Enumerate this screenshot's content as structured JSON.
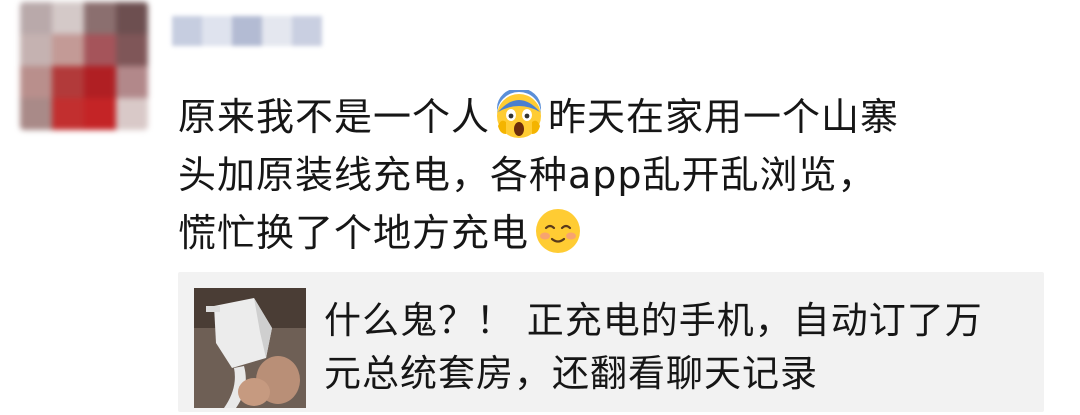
{
  "post": {
    "lines": [
      {
        "before": "原来我不是一个人",
        "emoji": "scream-emoji",
        "after": "昨天在家用一个山寨"
      },
      {
        "text": "头加原装线充电，各种app乱开乱浏览，"
      },
      {
        "before": "慌忙换了个地方充电",
        "emoji": "smiling-blush-emoji"
      }
    ]
  },
  "link_card": {
    "title_line1": "什么鬼？！ 正充电的手机，自动订了万",
    "title_line2": "元总统套房，还翻看聊天记录",
    "thumb_icon": "charger-photo"
  },
  "colors": {
    "text": "#161616",
    "card_bg": "#f2f2f2"
  }
}
